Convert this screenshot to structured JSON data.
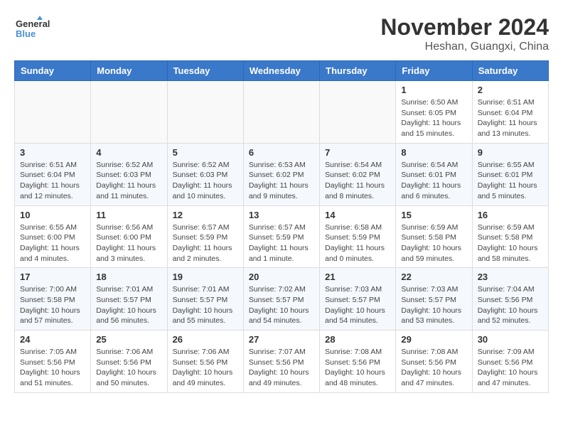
{
  "header": {
    "logo_line1": "General",
    "logo_line2": "Blue",
    "month": "November 2024",
    "location": "Heshan, Guangxi, China"
  },
  "weekdays": [
    "Sunday",
    "Monday",
    "Tuesday",
    "Wednesday",
    "Thursday",
    "Friday",
    "Saturday"
  ],
  "weeks": [
    [
      {
        "day": "",
        "info": ""
      },
      {
        "day": "",
        "info": ""
      },
      {
        "day": "",
        "info": ""
      },
      {
        "day": "",
        "info": ""
      },
      {
        "day": "",
        "info": ""
      },
      {
        "day": "1",
        "info": "Sunrise: 6:50 AM\nSunset: 6:05 PM\nDaylight: 11 hours and 15 minutes."
      },
      {
        "day": "2",
        "info": "Sunrise: 6:51 AM\nSunset: 6:04 PM\nDaylight: 11 hours and 13 minutes."
      }
    ],
    [
      {
        "day": "3",
        "info": "Sunrise: 6:51 AM\nSunset: 6:04 PM\nDaylight: 11 hours and 12 minutes."
      },
      {
        "day": "4",
        "info": "Sunrise: 6:52 AM\nSunset: 6:03 PM\nDaylight: 11 hours and 11 minutes."
      },
      {
        "day": "5",
        "info": "Sunrise: 6:52 AM\nSunset: 6:03 PM\nDaylight: 11 hours and 10 minutes."
      },
      {
        "day": "6",
        "info": "Sunrise: 6:53 AM\nSunset: 6:02 PM\nDaylight: 11 hours and 9 minutes."
      },
      {
        "day": "7",
        "info": "Sunrise: 6:54 AM\nSunset: 6:02 PM\nDaylight: 11 hours and 8 minutes."
      },
      {
        "day": "8",
        "info": "Sunrise: 6:54 AM\nSunset: 6:01 PM\nDaylight: 11 hours and 6 minutes."
      },
      {
        "day": "9",
        "info": "Sunrise: 6:55 AM\nSunset: 6:01 PM\nDaylight: 11 hours and 5 minutes."
      }
    ],
    [
      {
        "day": "10",
        "info": "Sunrise: 6:55 AM\nSunset: 6:00 PM\nDaylight: 11 hours and 4 minutes."
      },
      {
        "day": "11",
        "info": "Sunrise: 6:56 AM\nSunset: 6:00 PM\nDaylight: 11 hours and 3 minutes."
      },
      {
        "day": "12",
        "info": "Sunrise: 6:57 AM\nSunset: 5:59 PM\nDaylight: 11 hours and 2 minutes."
      },
      {
        "day": "13",
        "info": "Sunrise: 6:57 AM\nSunset: 5:59 PM\nDaylight: 11 hours and 1 minute."
      },
      {
        "day": "14",
        "info": "Sunrise: 6:58 AM\nSunset: 5:59 PM\nDaylight: 11 hours and 0 minutes."
      },
      {
        "day": "15",
        "info": "Sunrise: 6:59 AM\nSunset: 5:58 PM\nDaylight: 10 hours and 59 minutes."
      },
      {
        "day": "16",
        "info": "Sunrise: 6:59 AM\nSunset: 5:58 PM\nDaylight: 10 hours and 58 minutes."
      }
    ],
    [
      {
        "day": "17",
        "info": "Sunrise: 7:00 AM\nSunset: 5:58 PM\nDaylight: 10 hours and 57 minutes."
      },
      {
        "day": "18",
        "info": "Sunrise: 7:01 AM\nSunset: 5:57 PM\nDaylight: 10 hours and 56 minutes."
      },
      {
        "day": "19",
        "info": "Sunrise: 7:01 AM\nSunset: 5:57 PM\nDaylight: 10 hours and 55 minutes."
      },
      {
        "day": "20",
        "info": "Sunrise: 7:02 AM\nSunset: 5:57 PM\nDaylight: 10 hours and 54 minutes."
      },
      {
        "day": "21",
        "info": "Sunrise: 7:03 AM\nSunset: 5:57 PM\nDaylight: 10 hours and 54 minutes."
      },
      {
        "day": "22",
        "info": "Sunrise: 7:03 AM\nSunset: 5:57 PM\nDaylight: 10 hours and 53 minutes."
      },
      {
        "day": "23",
        "info": "Sunrise: 7:04 AM\nSunset: 5:56 PM\nDaylight: 10 hours and 52 minutes."
      }
    ],
    [
      {
        "day": "24",
        "info": "Sunrise: 7:05 AM\nSunset: 5:56 PM\nDaylight: 10 hours and 51 minutes."
      },
      {
        "day": "25",
        "info": "Sunrise: 7:06 AM\nSunset: 5:56 PM\nDaylight: 10 hours and 50 minutes."
      },
      {
        "day": "26",
        "info": "Sunrise: 7:06 AM\nSunset: 5:56 PM\nDaylight: 10 hours and 49 minutes."
      },
      {
        "day": "27",
        "info": "Sunrise: 7:07 AM\nSunset: 5:56 PM\nDaylight: 10 hours and 49 minutes."
      },
      {
        "day": "28",
        "info": "Sunrise: 7:08 AM\nSunset: 5:56 PM\nDaylight: 10 hours and 48 minutes."
      },
      {
        "day": "29",
        "info": "Sunrise: 7:08 AM\nSunset: 5:56 PM\nDaylight: 10 hours and 47 minutes."
      },
      {
        "day": "30",
        "info": "Sunrise: 7:09 AM\nSunset: 5:56 PM\nDaylight: 10 hours and 47 minutes."
      }
    ]
  ]
}
